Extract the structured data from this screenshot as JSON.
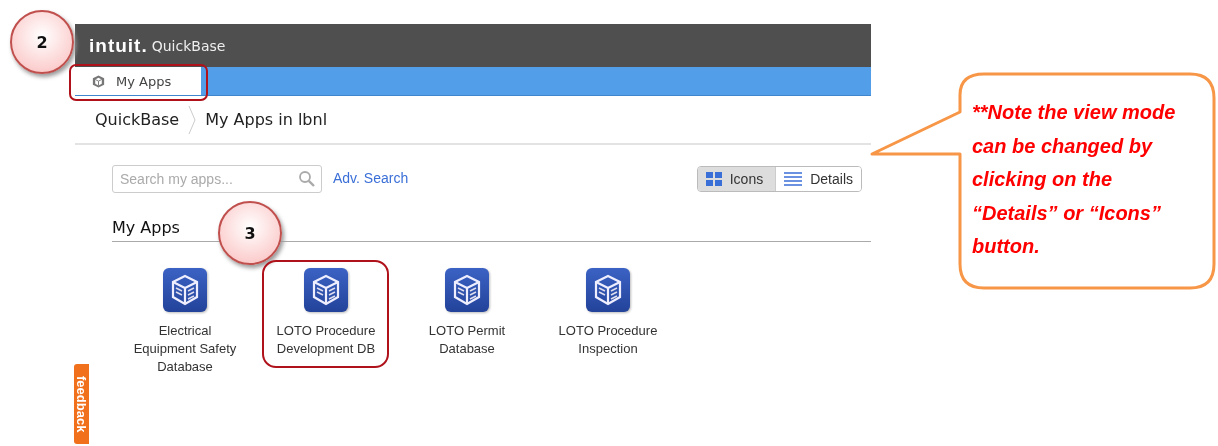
{
  "header": {
    "logo": "intuit.",
    "product": "QuickBase"
  },
  "nav_tabs": [
    {
      "label": "My Apps",
      "selected": true
    }
  ],
  "breadcrumb": [
    "QuickBase",
    "My Apps in lbnl"
  ],
  "search": {
    "placeholder": "Search my apps...",
    "link": "Adv. Search"
  },
  "view_toggle": [
    {
      "label": "Icons",
      "kind": "grid",
      "selected": true
    },
    {
      "label": "Details",
      "kind": "list",
      "selected": false
    }
  ],
  "section_title": "My Apps",
  "apps": [
    {
      "name": "Electrical Equipment Safety Database"
    },
    {
      "name": "LOTO Procedure Development DB"
    },
    {
      "name": "LOTO Permit Database"
    },
    {
      "name": "LOTO Procedure Inspection"
    }
  ],
  "feedback": "feedback",
  "annotations": {
    "steps": [
      {
        "number": "2"
      },
      {
        "number": "3"
      }
    ],
    "callout": "**Note the view mode can be changed by clicking on the “Details” or “Icons” button."
  }
}
